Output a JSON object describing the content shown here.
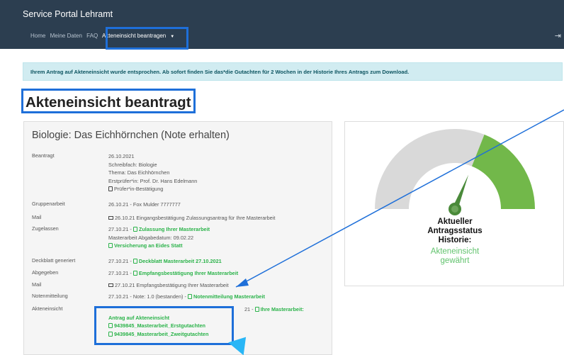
{
  "app": {
    "title": "Service Portal Lehramt"
  },
  "nav": {
    "items": [
      "Home",
      "Meine Daten",
      "FAQ"
    ],
    "active": "Akteneinsicht beantragen"
  },
  "alert": {
    "text": "Ihrem Antrag auf Akteneinsicht wurde entsprochen. Ab sofort finden Sie das*die Gutachten für 2 Wochen in der Historie Ihres Antrags zum Download."
  },
  "page": {
    "title": "Akteneinsicht beantragt"
  },
  "card": {
    "title": "Biologie: Das Eichhörnchen (Note erhalten)",
    "beantragt": {
      "label": "Beantragt",
      "date": "26.10.2021",
      "fach": "Schreibfach: Biologie",
      "thema": "Thema: Das Eichhörnchen",
      "pruefer": "Erstprüfer*in: Prof. Dr. Hans Edelmann",
      "link": "Prüfer*in-Bestätigung"
    },
    "gruppe": {
      "label": "Gruppenarbeit",
      "value": "26.10.21 - Fox Mulder 7777777"
    },
    "mail1": {
      "label": "Mail",
      "value": "26.10.21 Eingangsbestätigung Zulassungsantrag für Ihre Masterarbeit"
    },
    "zugelassen": {
      "label": "Zugelassen",
      "prefix": "27.10.21 - ",
      "link": "Zulassung Ihrer Masterarbeit",
      "datum": "Masterarbeit Abgabedatum: 09.02.22",
      "link2": "Versicherung an Eides Statt"
    },
    "deckblatt": {
      "label": "Deckblatt generiert",
      "prefix": "27.10.21 - ",
      "link": "Deckblatt Masterarbeit 27.10.2021"
    },
    "abgegeben": {
      "label": "Abgegeben",
      "prefix": "27.10.21 - ",
      "link": "Empfangsbestätigung Ihrer Masterarbeit"
    },
    "mail2": {
      "label": "Mail",
      "value": "27.10.21 Empfangsbestätigung Ihrer Masterarbeit"
    },
    "noten": {
      "label": "Notenmitteilung",
      "prefix": "27.10.21 - Note: 1.0 (bestanden) - ",
      "link": "Notenmitteilung Masterarbeit"
    },
    "akte": {
      "label": "Akteneinsicht",
      "prefix": "21 - ",
      "link1": "Ihre Masterarbeit:",
      "link2": "Antrag auf Akteneinsicht",
      "file1": "9439845_Masterarbeit_Erstgutachten",
      "file2": "9439845_Masterarbeit_Zweitgutachten"
    }
  },
  "gauge": {
    "line1": "Aktueller",
    "line2": "Antragsstatus",
    "line3": "Historie:",
    "status1": "Akteneinsicht",
    "status2": "gewährt",
    "level": 0.62,
    "colors": {
      "fill": "#72b84a",
      "track": "#d9d9d9",
      "needle": "#4a8a3a",
      "highlight": "#1e6fd9"
    }
  }
}
